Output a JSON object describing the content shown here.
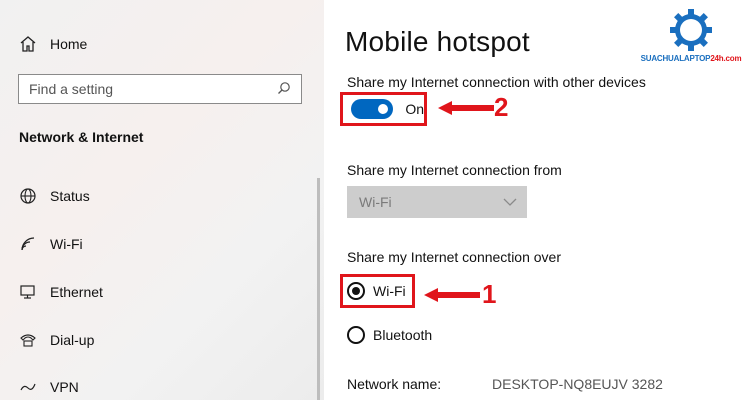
{
  "sidebar": {
    "home_label": "Home",
    "search_placeholder": "Find a setting",
    "section_title": "Network & Internet",
    "items": [
      {
        "label": "Status",
        "icon": "globe-icon"
      },
      {
        "label": "Wi-Fi",
        "icon": "wifi-icon"
      },
      {
        "label": "Ethernet",
        "icon": "ethernet-icon"
      },
      {
        "label": "Dial-up",
        "icon": "dialup-icon"
      },
      {
        "label": "VPN",
        "icon": "vpn-icon"
      }
    ]
  },
  "main": {
    "title": "Mobile hotspot",
    "share_label": "Share my Internet connection with other devices",
    "toggle": {
      "state_label": "On",
      "on": true
    },
    "from_label": "Share my Internet connection from",
    "from_select": {
      "value": "Wi-Fi",
      "disabled": true
    },
    "over_label": "Share my Internet connection over",
    "over_options": [
      {
        "label": "Wi-Fi",
        "checked": true
      },
      {
        "label": "Bluetooth",
        "checked": false
      }
    ],
    "network_name_label": "Network name:",
    "network_name_value": "DESKTOP-NQ8EUJV 3282"
  },
  "annotations": {
    "step_toggle": "2",
    "step_wifi": "1",
    "color": "#e0151b"
  },
  "logo": {
    "text_main": "SUACHUALAPTOP",
    "text_accent": "24h.com",
    "icon": "gear-compass-icon"
  },
  "colors": {
    "accent": "#0067c0",
    "highlight_red": "#e0151b"
  }
}
